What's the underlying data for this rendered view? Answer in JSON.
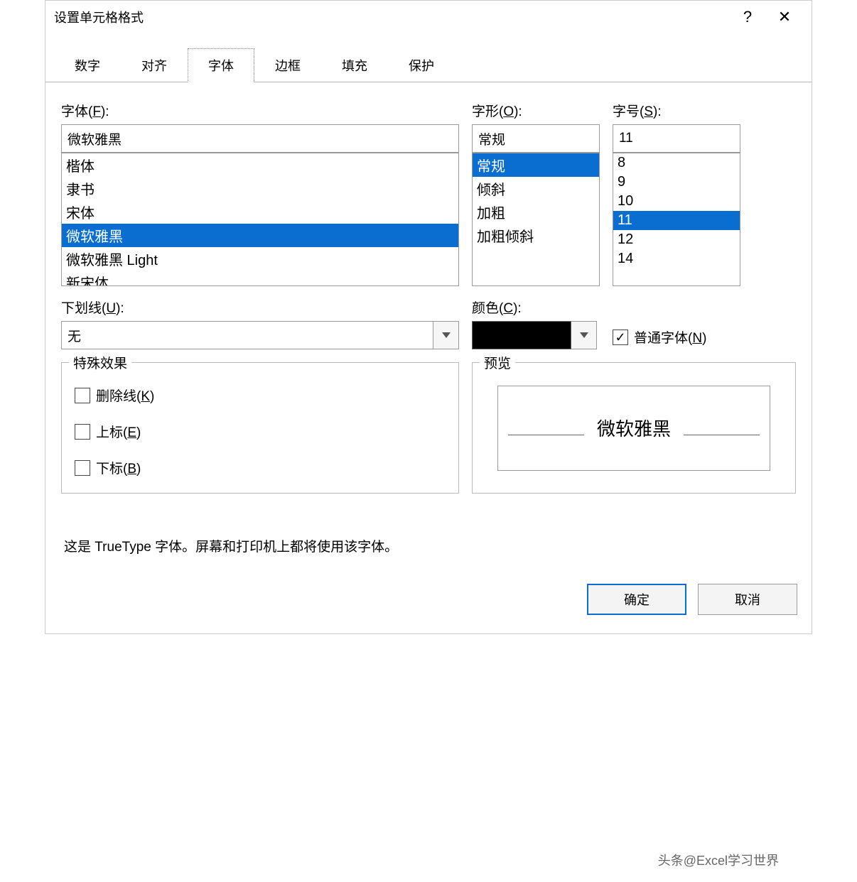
{
  "dialog": {
    "title": "设置单元格格式"
  },
  "titlebar": {
    "help": "?",
    "close": "✕"
  },
  "tabs": [
    "数字",
    "对齐",
    "字体",
    "边框",
    "填充",
    "保护"
  ],
  "active_tab_index": 2,
  "font": {
    "label_prefix": "字体(",
    "label_key": "F",
    "label_suffix": "):",
    "value": "微软雅黑",
    "options": [
      "楷体",
      "隶书",
      "宋体",
      "微软雅黑",
      "微软雅黑 Light",
      "新宋体"
    ],
    "selected_index": 3
  },
  "style": {
    "label_prefix": "字形(",
    "label_key": "O",
    "label_suffix": "):",
    "value": "常规",
    "options": [
      "常规",
      "倾斜",
      "加粗",
      "加粗倾斜"
    ],
    "selected_index": 0
  },
  "size": {
    "label_prefix": "字号(",
    "label_key": "S",
    "label_suffix": "):",
    "value": "11",
    "options": [
      "8",
      "9",
      "10",
      "11",
      "12",
      "14"
    ],
    "selected_index": 3
  },
  "underline": {
    "label_prefix": "下划线(",
    "label_key": "U",
    "label_suffix": "):",
    "value": "无"
  },
  "color": {
    "label_prefix": "颜色(",
    "label_key": "C",
    "label_suffix": "):",
    "swatch": "#000000"
  },
  "normal_font": {
    "checked": true,
    "label_prefix": "普通字体(",
    "label_key": "N",
    "label_suffix": ")"
  },
  "effects": {
    "legend": "特殊效果",
    "strike_prefix": "删除线(",
    "strike_key": "K",
    "strike_suffix": ")",
    "super_prefix": "上标(",
    "super_key": "E",
    "super_suffix": ")",
    "sub_prefix": "下标(",
    "sub_key": "B",
    "sub_suffix": ")"
  },
  "preview": {
    "legend": "预览",
    "sample": "微软雅黑"
  },
  "hint": "这是 TrueType 字体。屏幕和打印机上都将使用该字体。",
  "buttons": {
    "ok": "确定",
    "cancel": "取消"
  },
  "watermark": "头条@Excel学习世界"
}
